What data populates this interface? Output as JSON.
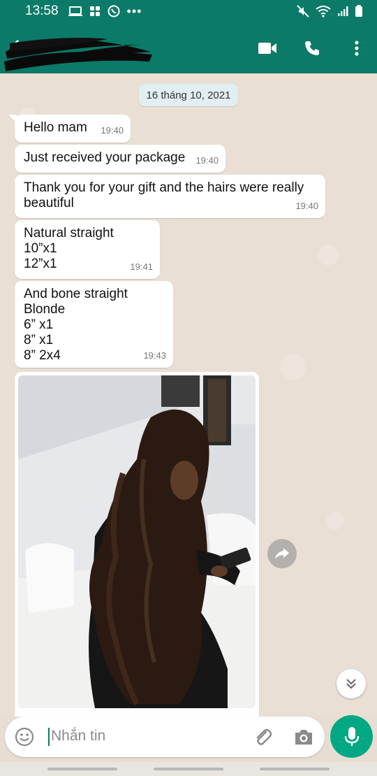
{
  "status_bar": {
    "time": "13:58"
  },
  "app_bar": {
    "back_icon": "arrow-left-icon",
    "contact_name_redacted": true,
    "actions": [
      "video-call-icon",
      "phone-icon",
      "more-vert-icon"
    ]
  },
  "chat": {
    "date_chip": "16 tháng 10, 2021",
    "messages": [
      {
        "lines": [
          "Hello mam"
        ],
        "time": "19:40"
      },
      {
        "lines": [
          "Just received your package"
        ],
        "time": "19:40"
      },
      {
        "lines": [
          "Thank you for your gift and the hairs were really",
          "beautiful"
        ],
        "time": "19:40"
      },
      {
        "lines": [
          "Natural straight",
          "10”x1",
          "12”x1"
        ],
        "time": "19:41"
      },
      {
        "lines": [
          "And bone straight",
          "Blonde",
          "6” x1",
          "8” x1",
          "8” 2x4"
        ],
        "time": "19:43"
      }
    ],
    "image_message": {
      "type": "photo"
    }
  },
  "composer": {
    "placeholder": "Nhắn tin"
  },
  "colors": {
    "header": "#0c7a68",
    "accent": "#00a884",
    "wallpaper": "#e9dfd5"
  }
}
